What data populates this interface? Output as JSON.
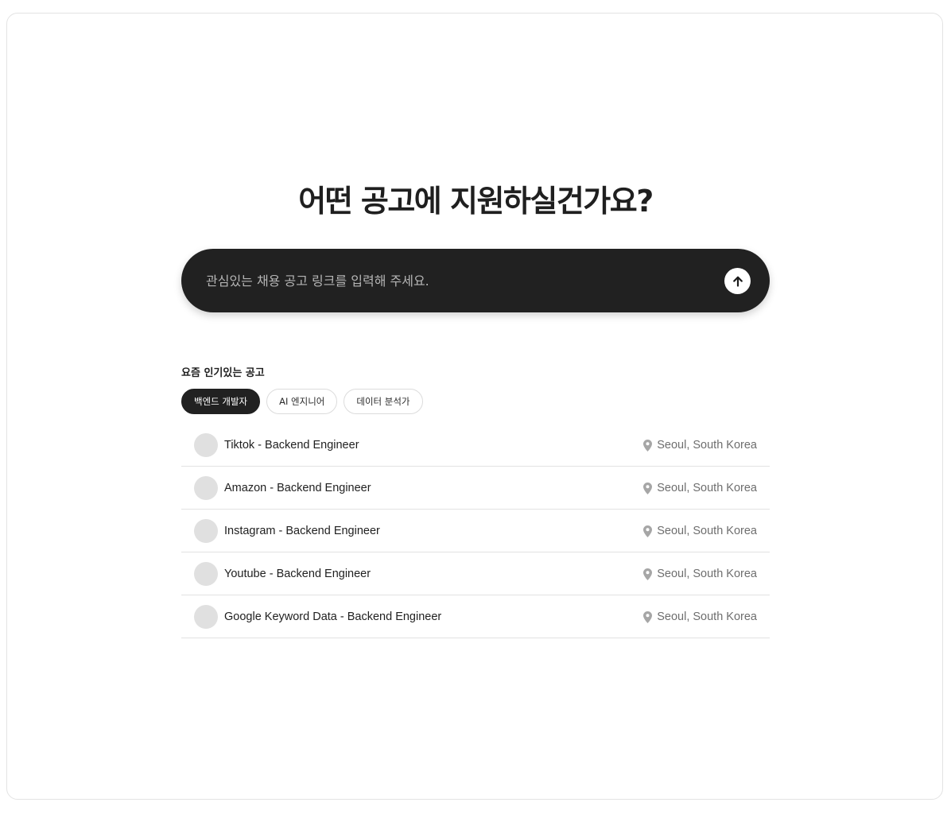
{
  "hero": {
    "headline": "어떤 공고에 지원하실건가요?"
  },
  "search": {
    "placeholder": "관심있는 채용 공고 링크를 입력해 주세요.",
    "value": "",
    "submit_icon": "arrow-up-icon"
  },
  "popular": {
    "title": "요즘 인기있는 공고",
    "tabs": [
      {
        "label": "백엔드 개발자",
        "active": true
      },
      {
        "label": "AI 엔지니어",
        "active": false
      },
      {
        "label": "데이터 분석가",
        "active": false
      }
    ],
    "jobs": [
      {
        "title": "Tiktok - Backend Engineer",
        "location": "Seoul, South Korea"
      },
      {
        "title": "Amazon - Backend Engineer",
        "location": "Seoul, South Korea"
      },
      {
        "title": "Instagram - Backend Engineer",
        "location": "Seoul, South Korea"
      },
      {
        "title": "Youtube - Backend Engineer",
        "location": "Seoul, South Korea"
      },
      {
        "title": "Google Keyword Data - Backend Engineer",
        "location": "Seoul, South Korea"
      }
    ]
  },
  "colors": {
    "primary_dark": "#212121",
    "placeholder_avatar": "#e0e0e0",
    "location_text": "#6e6e6e",
    "pin_icon": "#a6a6a6"
  }
}
